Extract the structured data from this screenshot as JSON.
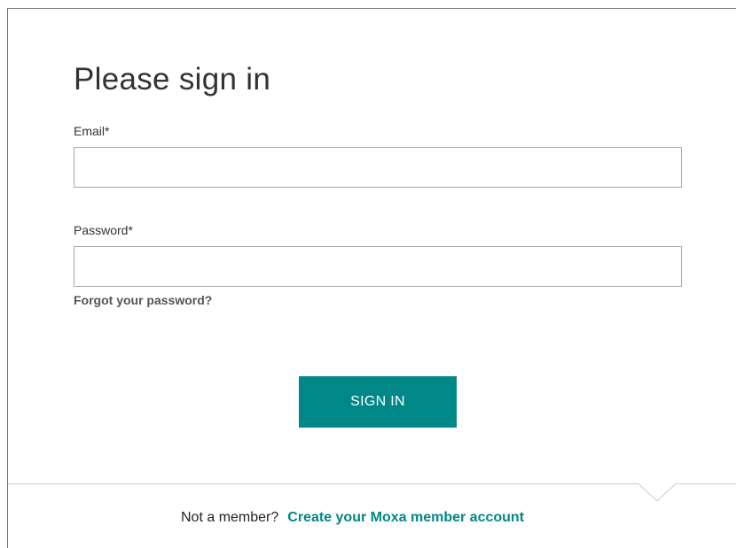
{
  "form": {
    "title": "Please sign in",
    "email_label": "Email*",
    "email_value": "",
    "password_label": "Password*",
    "password_value": "",
    "forgot_link": "Forgot your password?",
    "signin_button": "SIGN IN"
  },
  "footer": {
    "prompt": "Not a member?",
    "create_link": "Create your Moxa member account"
  },
  "colors": {
    "accent": "#008787",
    "border": "#aaaaaa",
    "text": "#333333"
  }
}
